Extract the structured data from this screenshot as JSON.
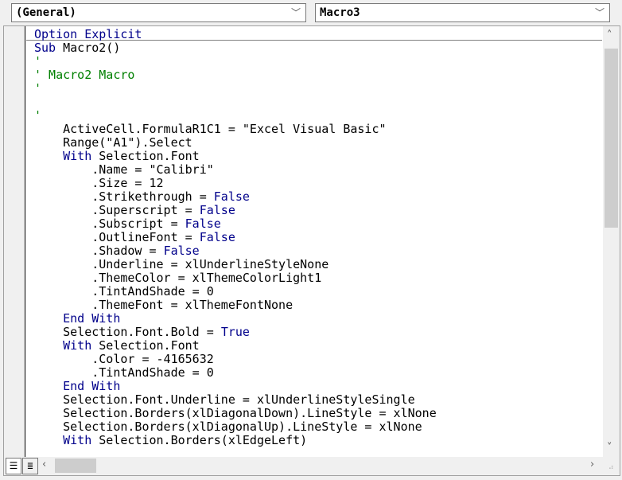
{
  "object_combo": {
    "value": "(General)"
  },
  "procedure_combo": {
    "value": "Macro3"
  },
  "code_lines": [
    [
      [
        "kw",
        "Option Explicit"
      ]
    ],
    [
      [
        "kw",
        "Sub"
      ],
      [
        "",
        "Macro2()"
      ]
    ],
    [
      [
        "cm",
        "'"
      ]
    ],
    [
      [
        "cm",
        "' Macro2 Macro"
      ]
    ],
    [
      [
        "cm",
        "'"
      ]
    ],
    [],
    [
      [
        "cm",
        "'"
      ]
    ],
    [
      [
        "",
        "    ActiveCell.FormulaR1C1 = \"Excel Visual Basic\""
      ]
    ],
    [
      [
        "",
        "    Range(\"A1\").Select"
      ]
    ],
    [
      [
        "kw",
        "    With"
      ],
      [
        "",
        "Selection.Font"
      ]
    ],
    [
      [
        "",
        "        .Name = \"Calibri\""
      ]
    ],
    [
      [
        "",
        "        .Size = 12"
      ]
    ],
    [
      [
        "",
        "        .Strikethrough = "
      ],
      [
        "kw",
        "False"
      ]
    ],
    [
      [
        "",
        "        .Superscript = "
      ],
      [
        "kw",
        "False"
      ]
    ],
    [
      [
        "",
        "        .Subscript = "
      ],
      [
        "kw",
        "False"
      ]
    ],
    [
      [
        "",
        "        .OutlineFont = "
      ],
      [
        "kw",
        "False"
      ]
    ],
    [
      [
        "",
        "        .Shadow = "
      ],
      [
        "kw",
        "False"
      ]
    ],
    [
      [
        "",
        "        .Underline = xlUnderlineStyleNone"
      ]
    ],
    [
      [
        "",
        "        .ThemeColor = xlThemeColorLight1"
      ]
    ],
    [
      [
        "",
        "        .TintAndShade = 0"
      ]
    ],
    [
      [
        "",
        "        .ThemeFont = xlThemeFontNone"
      ]
    ],
    [
      [
        "kw",
        "    End With"
      ]
    ],
    [
      [
        "",
        "    Selection.Font.Bold = "
      ],
      [
        "kw",
        "True"
      ]
    ],
    [
      [
        "kw",
        "    With"
      ],
      [
        "",
        "Selection.Font"
      ]
    ],
    [
      [
        "",
        "        .Color = -4165632"
      ]
    ],
    [
      [
        "",
        "        .TintAndShade = 0"
      ]
    ],
    [
      [
        "kw",
        "    End With"
      ]
    ],
    [
      [
        "",
        "    Selection.Font.Underline = xlUnderlineStyleSingle"
      ]
    ],
    [
      [
        "",
        "    Selection.Borders(xlDiagonalDown).LineStyle = xlNone"
      ]
    ],
    [
      [
        "",
        "    Selection.Borders(xlDiagonalUp).LineStyle = xlNone"
      ]
    ],
    [
      [
        "kw",
        "    With"
      ],
      [
        "",
        "Selection.Borders(xlEdgeLeft)"
      ]
    ]
  ]
}
